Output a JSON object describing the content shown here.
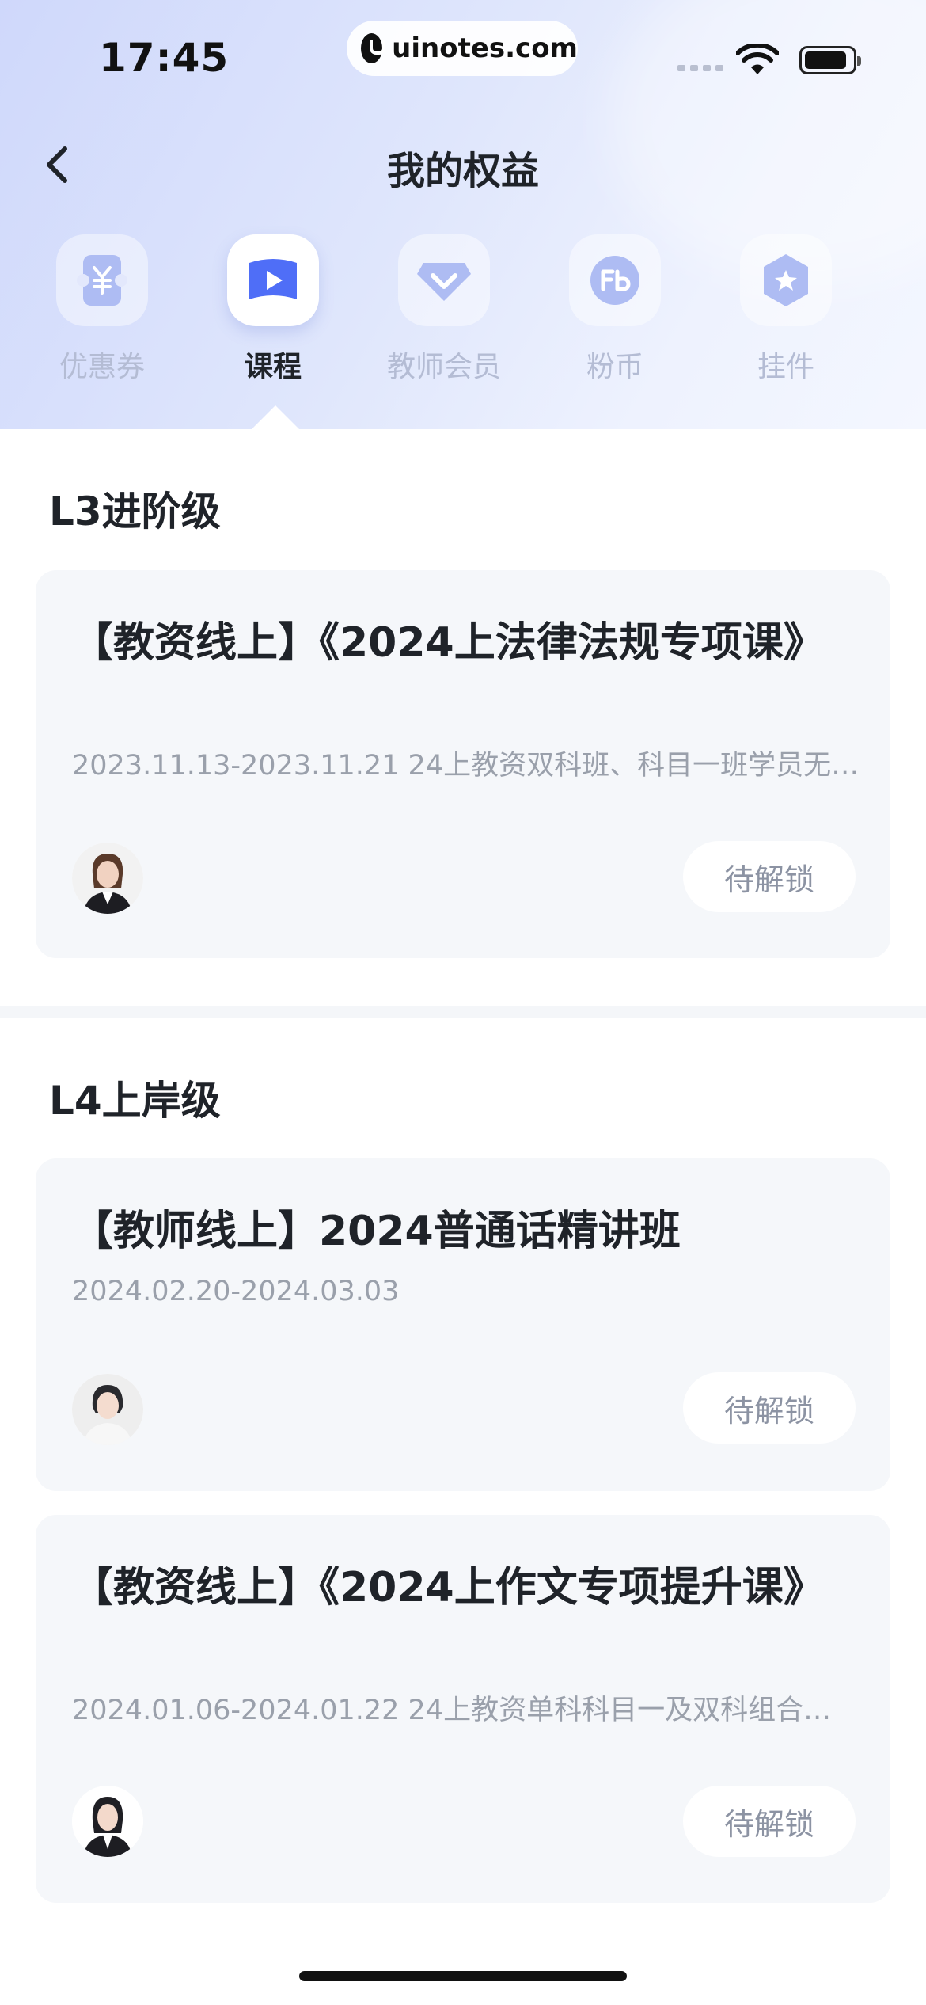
{
  "status_bar": {
    "time": "17:45",
    "url": "uinotes.com"
  },
  "nav": {
    "title": "我的权益",
    "back_icon": "chevron-left-icon"
  },
  "tabs": [
    {
      "label": "优惠券",
      "icon": "coupon-icon",
      "active": false
    },
    {
      "label": "课程",
      "icon": "play-course-icon",
      "active": true
    },
    {
      "label": "教师会员",
      "icon": "teacher-member-icon",
      "active": false
    },
    {
      "label": "粉币",
      "icon": "coin-icon",
      "active": false
    },
    {
      "label": "挂件",
      "icon": "pendant-icon",
      "active": false
    }
  ],
  "sections": [
    {
      "title": "L3进阶级",
      "cards": [
        {
          "title": "【教资线上】《2024上法律法规专项课》",
          "desc": "2023.11.13-2023.11.21 24上教资双科班、科目一班学员无…",
          "button": "待解锁"
        }
      ]
    },
    {
      "title": "L4上岸级",
      "cards": [
        {
          "title": "【教师线上】2024普通话精讲班",
          "desc": "2024.02.20-2024.03.03",
          "button": "待解锁"
        },
        {
          "title": "【教资线上】《2024上作文专项提升课》",
          "desc": "2024.01.06-2024.01.22 24上教资单科科目一及双科组合…",
          "button": "待解锁"
        }
      ]
    }
  ],
  "colors": {
    "accent": "#4f6ef7",
    "hero_bg": "#dfe6fc",
    "card_bg": "#f5f7fa",
    "muted_text": "#9aa0ab"
  }
}
